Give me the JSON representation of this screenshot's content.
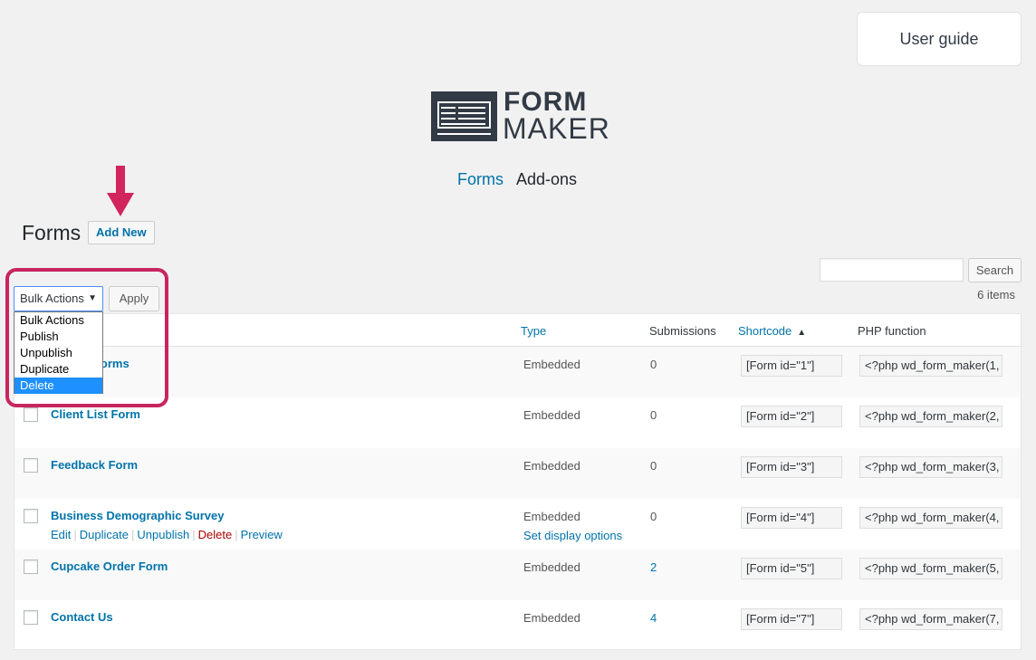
{
  "header": {
    "user_guide": "User guide"
  },
  "logo": {
    "line1": "FORM",
    "line2": "MAKER"
  },
  "nav": {
    "forms": "Forms",
    "addons": "Add-ons"
  },
  "page": {
    "title": "Forms",
    "add_new": "Add New"
  },
  "search": {
    "button": "Search",
    "count": "6 items"
  },
  "bulk": {
    "selected": "Bulk Actions",
    "apply": "Apply",
    "options": [
      "Bulk Actions",
      "Publish",
      "Unpublish",
      "Duplicate",
      "Delete"
    ],
    "highlighted": "Delete"
  },
  "columns": {
    "type": "Type",
    "submissions": "Submissions",
    "shortcode": "Shortcode",
    "php": "PHP function"
  },
  "rows": [
    {
      "title": "Sign in Forms",
      "type": "Embedded",
      "subs": "0",
      "shortcode": "[Form id=\"1\"]",
      "php": "<?php wd_form_maker(1,"
    },
    {
      "title": "Client List Form",
      "type": "Embedded",
      "subs": "0",
      "shortcode": "[Form id=\"2\"]",
      "php": "<?php wd_form_maker(2,"
    },
    {
      "title": "Feedback Form",
      "type": "Embedded",
      "subs": "0",
      "shortcode": "[Form id=\"3\"]",
      "php": "<?php wd_form_maker(3,"
    },
    {
      "title": "Business Demographic Survey",
      "type": "Embedded",
      "type_sub": "Set display options",
      "subs": "0",
      "shortcode": "[Form id=\"4\"]",
      "php": "<?php wd_form_maker(4,",
      "actions": {
        "edit": "Edit",
        "duplicate": "Duplicate",
        "unpublish": "Unpublish",
        "delete": "Delete",
        "preview": "Preview"
      }
    },
    {
      "title": "Cupcake Order Form",
      "type": "Embedded",
      "subs": "2",
      "shortcode": "[Form id=\"5\"]",
      "php": "<?php wd_form_maker(5,"
    },
    {
      "title": "Contact Us",
      "type": "Embedded",
      "subs": "4",
      "shortcode": "[Form id=\"7\"]",
      "php": "<?php wd_form_maker(7,"
    }
  ],
  "colors": {
    "accent": "#0073aa",
    "highlight": "#c8255f",
    "delete": "#aa0000"
  }
}
